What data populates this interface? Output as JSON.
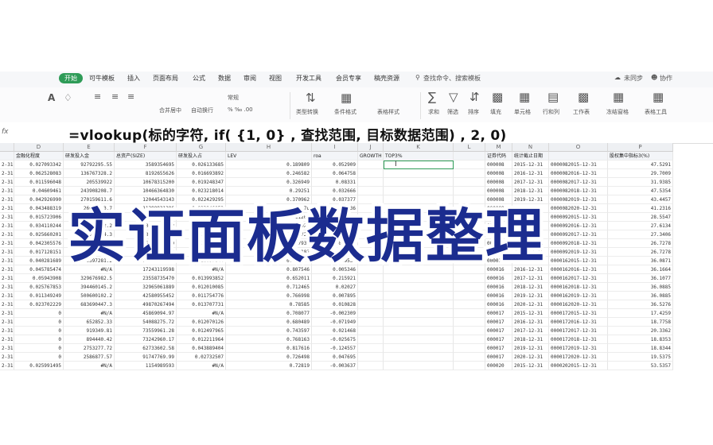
{
  "menu": {
    "tabs": [
      "开始",
      "可牛模板",
      "插入",
      "页面布局",
      "公式",
      "数据",
      "审阅",
      "视图",
      "开发工具",
      "会员专享",
      "稿壳资源"
    ],
    "active_tab": "开始",
    "search_placeholder": "查找命令、搜索模板",
    "cloud": "未同步",
    "collab": "协作"
  },
  "toolbar": {
    "buttons": [
      "合并居中",
      "自动换行",
      "常规",
      "类型转换",
      "条件格式",
      "表格样式",
      "求和",
      "筛选",
      "排序",
      "填充",
      "单元格",
      "行和列",
      "工作表",
      "冻结窗格",
      "表格工具"
    ]
  },
  "formula": {
    "fx": "fx",
    "text": "=vlookup(标的字符, if( {1, 0} , 查找范围, 目标数据范围) , 2, 0)"
  },
  "sheet": {
    "columns": [
      "",
      "D",
      "E",
      "F",
      "G",
      "H",
      "I",
      "J",
      "K",
      "L",
      "M",
      "N",
      "O",
      "P"
    ],
    "header_row": [
      "",
      "金融化程度",
      "研发投入金",
      "总资产(SIZE)",
      "研发投入占",
      "LEV",
      "roa",
      "GROWTH",
      "TOP3%",
      "",
      "证券代码",
      "统计截止日期",
      "",
      "股权集中指标3(%)"
    ],
    "rows": [
      [
        "2-31",
        "0.027093342",
        "92792295.55",
        "3589354695",
        "0.026133685",
        "0.189809",
        "0.052909",
        "",
        "",
        "",
        "000008",
        "2015-12-31",
        "0000082015-12-31",
        "47.5291"
      ],
      [
        "2-31",
        "0.062528083",
        "136767328.2",
        "8192655626",
        "0.016693892",
        "0.246582",
        "0.064758",
        "",
        "",
        "",
        "000008",
        "2016-12-31",
        "0000082016-12-31",
        "29.7009"
      ],
      [
        "2-31",
        "0.011596048",
        "205539922",
        "10678315200",
        "0.019248347",
        "0.326949",
        "0.08331",
        "",
        "",
        "",
        "000008",
        "2017-12-31",
        "0000082017-12-31",
        "31.9385"
      ],
      [
        "2-31",
        "0.04609461",
        "243908208.7",
        "10466364830",
        "0.023218014",
        "0.29251",
        "0.032666",
        "",
        "",
        "",
        "000008",
        "2018-12-31",
        "0000082018-12-31",
        "47.5354"
      ],
      [
        "2-31",
        "0.042926990",
        "270159611.6",
        "12044543143",
        "0.022429295",
        "0.370962",
        "0.037377",
        "",
        "",
        "",
        "000008",
        "2019-12-31",
        "0000082019-12-31",
        "43.4457"
      ],
      [
        "2-31",
        "0.043488319",
        "26908423.7",
        "11280931206",
        "0.023846052",
        "0.480178",
        "0.04136",
        "",
        "",
        "",
        "000008",
        "2020-12-31",
        "0000082020-12-31",
        "41.2316"
      ],
      [
        "2-31",
        "0.015723906",
        "130553883.4",
        "8456921705",
        "0.015321896",
        "0.511203",
        "0.04212",
        "",
        "",
        "",
        "000009",
        "2015-12-31",
        "0000092015-12-31",
        "28.5547"
      ],
      [
        "2-31",
        "0.034110244",
        "137804232.2",
        "10326117822",
        "0.013345428",
        "0.478025",
        "0.036118",
        "",
        "",
        "",
        "000009",
        "2016-12-31",
        "0000092016-12-31",
        "27.6134"
      ],
      [
        "2-31",
        "0.025660201",
        "264931044.3",
        "13028930552",
        "0.020334109",
        "0.455723",
        "0.030415",
        "",
        "",
        "",
        "000009",
        "2017-12-31",
        "0000092017-12-31",
        "27.3406"
      ],
      [
        "2-31",
        "0.042305576",
        "351244631.5",
        "15233411120",
        "0.023058223",
        "0.457931",
        "0.021786",
        "",
        "",
        "",
        "000009",
        "2018-12-31",
        "0000092018-12-31",
        "26.7278"
      ],
      [
        "2-31",
        "0.017128151",
        "433107497",
        "17882914898",
        "0.024219565",
        "0.465182",
        "-0.045474",
        "",
        "",
        "",
        "000009",
        "2019-12-31",
        "0000092019-12-31",
        "26.7278"
      ],
      [
        "2-31",
        "0.040281689",
        "229397281.2",
        "14250567548",
        "0.016097644",
        "0.784184",
        "-0.089531",
        "",
        "",
        "",
        "000016",
        "2015-12-31",
        "0000162015-12-31",
        "36.0871"
      ],
      [
        "2-31",
        "0.045785474",
        "#N/A",
        "17243119598",
        "#N/A",
        "0.807546",
        "0.005346",
        "",
        "",
        "",
        "000016",
        "2016-12-31",
        "0000162016-12-31",
        "36.1664"
      ],
      [
        "2-31",
        "0.05943908",
        "329676982.5",
        "23558735470",
        "0.013993852",
        "0.652011",
        "0.215921",
        "",
        "",
        "",
        "000016",
        "2017-12-31",
        "0000162017-12-31",
        "36.1077"
      ],
      [
        "2-31",
        "0.025767853",
        "394460145.2",
        "32965061889",
        "0.012010085",
        "0.712465",
        "0.02027",
        "",
        "",
        "",
        "000016",
        "2018-12-31",
        "0000162018-12-31",
        "36.0885"
      ],
      [
        "2-31",
        "0.011349249",
        "500600102.2",
        "42580955452",
        "0.011754776",
        "0.766998",
        "0.007895",
        "",
        "",
        "",
        "000016",
        "2019-12-31",
        "0000162019-12-31",
        "36.0885"
      ],
      [
        "2-31",
        "0.023702229",
        "683690447.3",
        "49870267494",
        "0.013707731",
        "0.78585",
        "0.010828",
        "",
        "",
        "",
        "000016",
        "2020-12-31",
        "0000162020-12-31",
        "36.5276"
      ],
      [
        "2-31",
        "0",
        "#N/A",
        "45869094.97",
        "#N/A",
        "0.708077",
        "-0.002309",
        "",
        "",
        "",
        "000017",
        "2015-12-31",
        "0000172015-12-31",
        "17.4259"
      ],
      [
        "2-31",
        "0",
        "652852.33",
        "54088275.72",
        "0.012070126",
        "0.680489",
        "-0.071949",
        "",
        "",
        "",
        "000017",
        "2016-12-31",
        "0000172016-12-31",
        "18.7758"
      ],
      [
        "2-31",
        "0",
        "919349.81",
        "73559961.28",
        "0.012497965",
        "0.743597",
        "0.021468",
        "",
        "",
        "",
        "000017",
        "2017-12-31",
        "0000172017-12-31",
        "20.3362"
      ],
      [
        "2-31",
        "0",
        "894440.42",
        "73242960.17",
        "0.012211964",
        "0.768163",
        "-0.025675",
        "",
        "",
        "",
        "000017",
        "2018-12-31",
        "0000172018-12-31",
        "18.8353"
      ],
      [
        "2-31",
        "0",
        "2753277.72",
        "62733602.58",
        "0.043889404",
        "0.817616",
        "-0.124557",
        "",
        "",
        "",
        "000017",
        "2019-12-31",
        "0000172019-12-31",
        "18.8344"
      ],
      [
        "2-31",
        "0",
        "2586877.57",
        "91747769.99",
        "0.02732507",
        "0.726498",
        "0.047695",
        "",
        "",
        "",
        "000017",
        "2020-12-31",
        "0000172020-12-31",
        "19.5375"
      ],
      [
        "2-31",
        "0.025991495",
        "#N/A",
        "1154989593",
        "#N/A",
        "0.72819",
        "-0.003637",
        "",
        "",
        "",
        "000020",
        "2015-12-31",
        "0000202015-12-31",
        "53.5357"
      ]
    ]
  },
  "overlay": {
    "title": "实证面板数据整理"
  }
}
